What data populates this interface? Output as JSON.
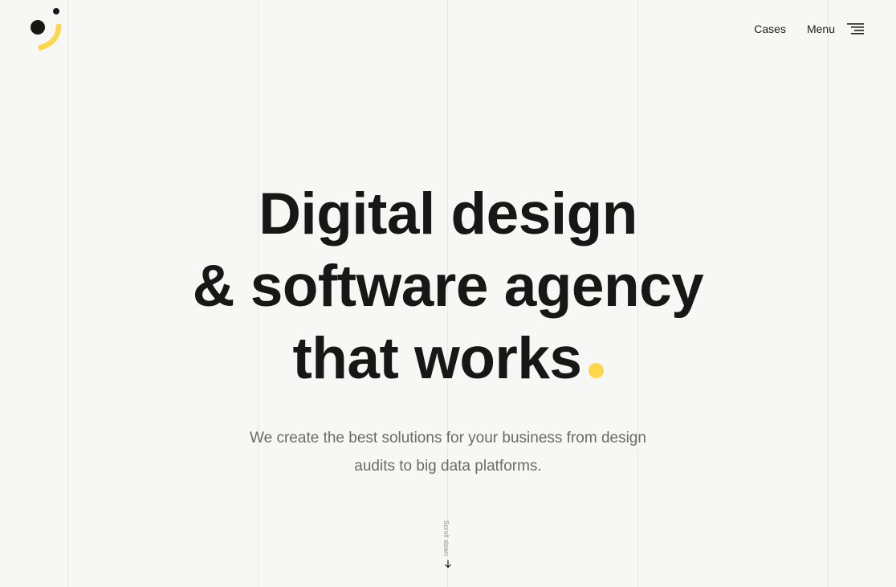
{
  "brand": {
    "accent_color": "#fdd64a",
    "ink_color": "#161616",
    "background_color": "#f7f7f5"
  },
  "nav": {
    "cases_label": "Cases",
    "menu_label": "Menu",
    "menu_icon": "hamburger-icon"
  },
  "hero": {
    "headline": [
      "Digital design",
      "& software agency",
      "that works"
    ],
    "subtitle": "We create the best solutions for your business from design audits to big data platforms."
  },
  "scroll": {
    "label": "Scroll down",
    "icon": "arrow-down-icon"
  }
}
